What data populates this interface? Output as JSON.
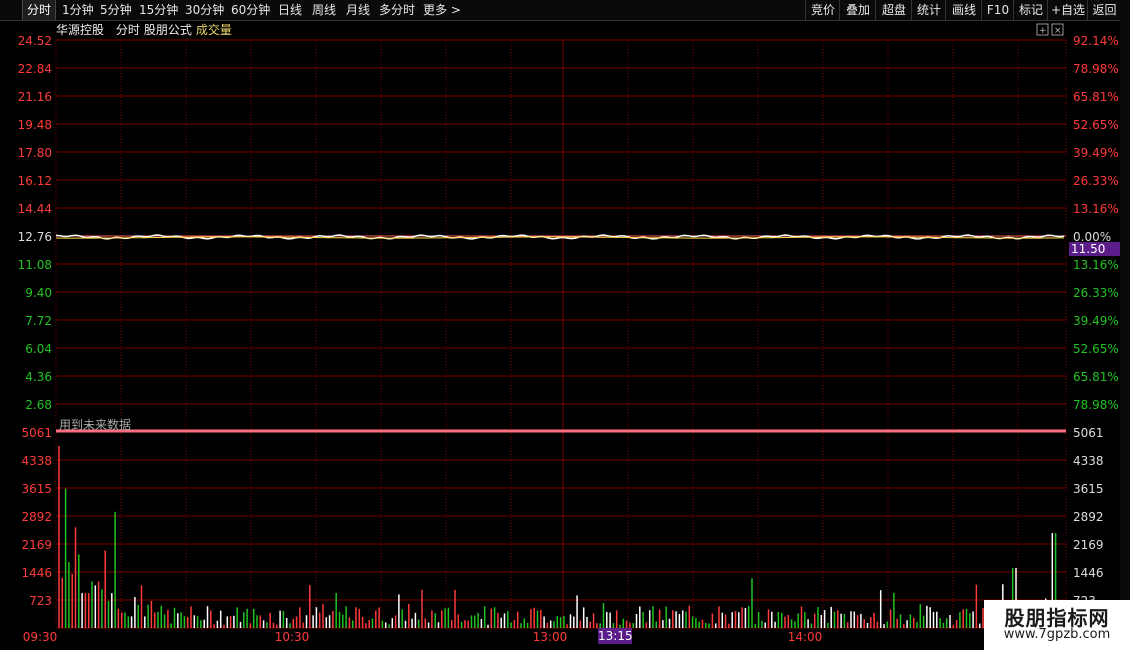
{
  "toolbar": {
    "periods": [
      "分时",
      "1分钟",
      "5分钟",
      "15分钟",
      "30分钟",
      "60分钟",
      "日线",
      "周线",
      "月线",
      "多分时",
      "更多 >"
    ],
    "active": "分时",
    "right_buttons": [
      "竞价",
      "叠加",
      "超盘",
      "统计",
      "画线",
      "F10",
      "标记",
      "+自选",
      "返回"
    ]
  },
  "header": {
    "stock_name": "华源控股",
    "chart_mode": "分时",
    "formula": "股朋公式",
    "indicator": "成交量"
  },
  "price_axis": {
    "left_labels": [
      "24.52",
      "22.84",
      "21.16",
      "19.48",
      "17.80",
      "16.12",
      "14.44",
      "12.76",
      "11.08",
      "9.40",
      "7.72",
      "6.04",
      "4.36",
      "2.68"
    ],
    "right_labels": [
      "92.14%",
      "78.98%",
      "65.81%",
      "52.65%",
      "39.49%",
      "26.33%",
      "13.16%",
      "0.00%",
      "13.16%",
      "26.33%",
      "39.49%",
      "52.65%",
      "65.81%",
      "78.98%"
    ],
    "current_price_tag": "11.50"
  },
  "volume_axis": {
    "labels": [
      "5061",
      "4338",
      "3615",
      "2892",
      "2169",
      "1446",
      "723"
    ],
    "warning_text": "用到未来数据"
  },
  "time_axis": {
    "labels": [
      "09:30",
      "10:30",
      "13:00",
      "14:00"
    ],
    "cursor_time": "13:15"
  },
  "colors": {
    "up": "#ff3b3b",
    "down": "#22c322",
    "flat": "#ffffff",
    "grid": "#7a0000",
    "price_line": "#ffffff",
    "avg_line": "#ffd84a",
    "cursor": "#5a1d8a"
  },
  "watermark": {
    "title": "股朋指标网",
    "url": "www.7gpzb.com"
  },
  "chart_data": {
    "type": "line",
    "title": "华源控股 分时",
    "prev_close": 12.76,
    "y_range": [
      2.68,
      24.52
    ],
    "volume_range": [
      0,
      5061
    ],
    "volume_sample": [
      4700,
      1300,
      3600,
      1700,
      1400,
      2600,
      1900,
      900,
      900,
      900,
      1200,
      1100,
      1200,
      1000,
      2000,
      700,
      900,
      3000,
      500,
      400,
      400,
      300,
      300,
      800,
      600,
      1100,
      300,
      600,
      700,
      400
    ]
  }
}
